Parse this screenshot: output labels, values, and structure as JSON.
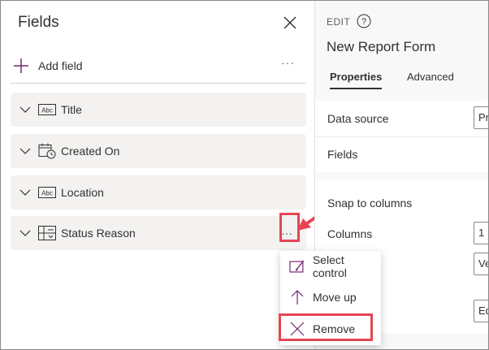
{
  "fields_pane": {
    "title": "Fields",
    "add_field_label": "Add field",
    "more_label": "···",
    "fields": [
      {
        "label": "Title",
        "icon": "text-field-icon"
      },
      {
        "label": "Created On",
        "icon": "calendar-icon"
      },
      {
        "label": "Location",
        "icon": "text-field-icon"
      },
      {
        "label": "Status Reason",
        "icon": "option-set-icon"
      }
    ]
  },
  "context_menu": {
    "items": [
      {
        "label": "Select control",
        "icon": "select-control-icon"
      },
      {
        "label": "Move up",
        "icon": "arrow-up-icon"
      },
      {
        "label": "Remove",
        "icon": "close-icon"
      }
    ]
  },
  "properties_pane": {
    "edit_label": "EDIT",
    "form_name": "New Report Form",
    "tabs": {
      "properties": "Properties",
      "advanced": "Advanced"
    },
    "data_source_label": "Data source",
    "data_source_value": "Pr",
    "fields_label": "Fields",
    "snap_label": "Snap to columns",
    "columns_label": "Columns",
    "columns_value": "1",
    "layout_value": "Ve",
    "mode_value": "Ed"
  },
  "colors": {
    "accent_purple": "#742774",
    "annotation_red": "#e64553",
    "card_bg": "#f3f2f1"
  }
}
